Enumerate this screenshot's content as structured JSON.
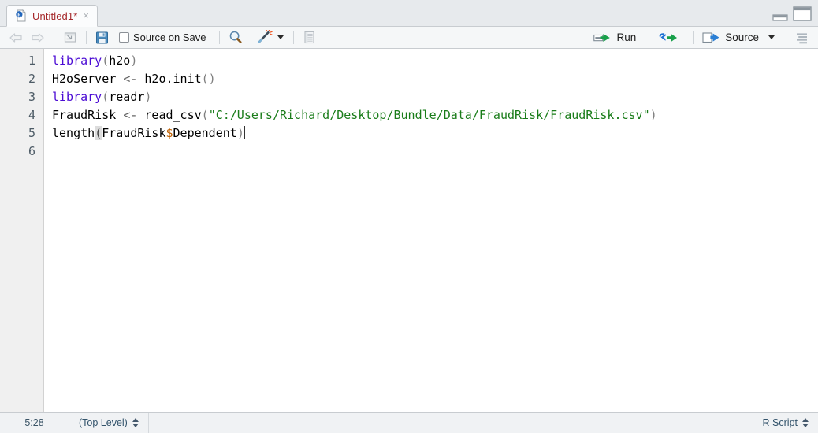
{
  "window": {
    "minimize_label": "Minimize",
    "maximize_label": "Maximize"
  },
  "tab": {
    "label": "Untitled1*",
    "close_label": "×",
    "icon": "r-script-file-icon"
  },
  "toolbar": {
    "back_label": "Back",
    "forward_label": "Forward",
    "popout_label": "Show in new window",
    "save_label": "Save current document",
    "source_on_save_label": "Source on Save",
    "source_on_save_checked": false,
    "find_label": "Find/Replace",
    "code_tools_label": "Code Tools",
    "code_tools_caret": "▾",
    "compile_report_label": "Compile Report",
    "run_label": "Run",
    "rerun_label": "Re-run previous code region",
    "source_label": "Source",
    "source_caret": "▾",
    "outline_label": "Show document outline"
  },
  "editor": {
    "line_numbers": [
      "1",
      "2",
      "3",
      "4",
      "5",
      "6"
    ],
    "lines": [
      {
        "number": "1",
        "tokens": [
          {
            "text": "library",
            "type": "fn"
          },
          {
            "text": "(",
            "type": "par"
          },
          {
            "text": "h2o",
            "type": "plain"
          },
          {
            "text": ")",
            "type": "par"
          }
        ]
      },
      {
        "number": "2",
        "tokens": [
          {
            "text": "H2oServer ",
            "type": "plain"
          },
          {
            "text": "<-",
            "type": "op"
          },
          {
            "text": " h2o.init",
            "type": "plain"
          },
          {
            "text": "()",
            "type": "par"
          }
        ]
      },
      {
        "number": "3",
        "tokens": [
          {
            "text": "library",
            "type": "fn"
          },
          {
            "text": "(",
            "type": "par"
          },
          {
            "text": "readr",
            "type": "plain"
          },
          {
            "text": ")",
            "type": "par"
          }
        ]
      },
      {
        "number": "4",
        "tokens": [
          {
            "text": "FraudRisk ",
            "type": "plain"
          },
          {
            "text": "<-",
            "type": "op"
          },
          {
            "text": " read_csv",
            "type": "plain"
          },
          {
            "text": "(",
            "type": "par"
          },
          {
            "text": "\"C:/Users/Richard/Desktop/Bundle/Data/FraudRisk/FraudRisk.csv\"",
            "type": "str"
          },
          {
            "text": ")",
            "type": "par"
          }
        ]
      },
      {
        "number": "5",
        "tokens": [
          {
            "text": "length",
            "type": "plain"
          },
          {
            "text": "(",
            "type": "parhl"
          },
          {
            "text": "FraudRisk",
            "type": "plain"
          },
          {
            "text": "$",
            "type": "dol"
          },
          {
            "text": "Dependent",
            "type": "plain"
          },
          {
            "text": ")",
            "type": "par"
          }
        ],
        "cursor_after": true
      },
      {
        "number": "6",
        "tokens": []
      }
    ]
  },
  "statusbar": {
    "position": "5:28",
    "scope": "(Top Level)",
    "file_type": "R Script"
  },
  "colors": {
    "tab_label": "#a5282b",
    "keyword": "#4b0bd4",
    "string": "#197c19",
    "dollar": "#c06000",
    "paren": "#7f7f7f",
    "run_arrow": "#18a04a",
    "rerun_arrow": "#1a6fd4",
    "save_icon": "#3f7fb5",
    "status_text": "#32536b",
    "editor_bg": "#ffffff",
    "gutter_bg": "#f0f0f0",
    "toolbar_bg": "#f5f7f8"
  }
}
